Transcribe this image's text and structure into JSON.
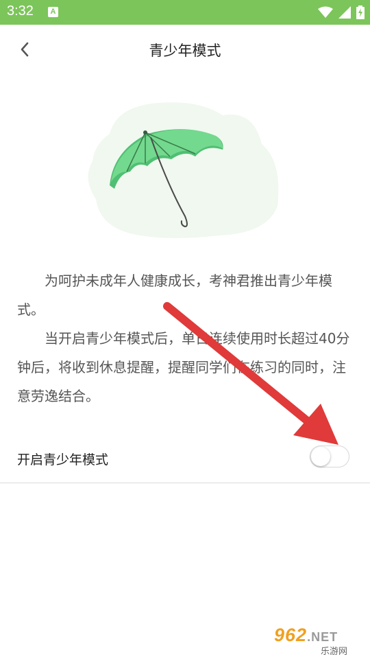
{
  "status_bar": {
    "time": "3:32",
    "app_icon_letter": "A",
    "bg_color": "#7cc55a",
    "icons": [
      "wifi-icon",
      "signal-icon",
      "battery-icon"
    ]
  },
  "header": {
    "title": "青少年模式",
    "back_icon": "chevron-left-icon"
  },
  "illustration": {
    "icon": "umbrella-icon",
    "umbrella_color": "#6fd68e",
    "backdrop_color": "#f0f8ef"
  },
  "description": {
    "paragraph1": "为呵护未成年人健康成长，考神君推出青少年模式。",
    "paragraph2": "当开启青少年模式后，单日连续使用时长超过40分钟后，将收到休息提醒，提醒同学们在练习的同时，注意劳逸结合。"
  },
  "toggle": {
    "label": "开启青少年模式",
    "enabled": false
  },
  "annotation": {
    "color": "#e03a3a"
  },
  "watermark": {
    "number": "962",
    "suffix": ".NET",
    "sub": "乐游网"
  }
}
